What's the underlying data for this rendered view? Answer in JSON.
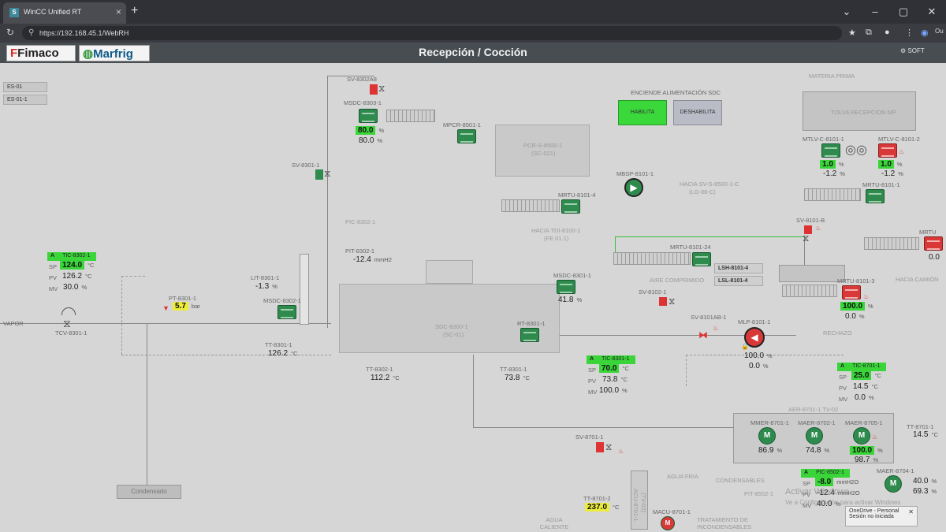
{
  "browser": {
    "tab_title": "WinCC Unified RT",
    "favicon": "S",
    "url": "https://192.168.45.1/WebRH",
    "profile": "Ou"
  },
  "header": {
    "title": "Recepción / Cocción",
    "logo1": "Fimaco",
    "logo2": "Marfrig",
    "logo3": "SOFT"
  },
  "side": {
    "es01": "ES-01",
    "es011": "ES-01-1"
  },
  "sdc": {
    "label": "ENCIENDE ALIMENTACIÓN SDC",
    "habilita": "HABILITA",
    "deshabilita": "DESHABILITA"
  },
  "tags": {
    "sv8302a8": "SV-8302A8",
    "msdc8303": "MSDC-8303-1",
    "msdc8303_v1": "80.0",
    "msdc8303_v2": "80.0",
    "mpcr8501": "MPCR-8501-1",
    "pcr": "PCR-S-8500-1",
    "pcr2": "(SC-021)",
    "sv8301": "SV-8301-1",
    "mbsp8101": "MBSP-8101-1",
    "hacia_sv": "HACIA SV-S-8500-1-C",
    "hacia_sv2": "(LG-06-C)",
    "mrtu8101_4": "MRTU-8101-4",
    "hacia_tdi": "HACIA TDI-8100-1",
    "hacia_tdi2": "(FE 01.1)",
    "pic8302": "PIC-8302-1",
    "pit8302": "PIT-8302-1",
    "pit8302_v": "-12.4",
    "pit8302_u": "mmH2",
    "lit8301": "LIT-8301-1",
    "lit8301_v": "-1.3",
    "lit8301_u": "%",
    "msdc8302": "MSDC-8302-1",
    "msdc8301": "MSDC-8301-1",
    "msdc8301_v": "41.8",
    "msdc8301_u": "%",
    "sdc": "SDC-8300-1",
    "sdc2": "(SC-01)",
    "rt8301": "RT-8301-1",
    "tt8301": "TT-8301-1",
    "tt8301_v": "126.2",
    "tt8301_u": "°C",
    "tt8302": "TT-8302-1",
    "tt8302_v": "112.2",
    "tt8302_u": "°C",
    "tt8301b": "TT-8301-1",
    "tt8301b_v": "73.8",
    "tt8301b_u": "°C",
    "tic8302": "TIC-8302-1",
    "tic8302_mode": "A",
    "tic8302_sp": "124.0",
    "tic8302_pv": "126.2",
    "tic8302_mv": "30.0",
    "pt8301": "PT-8301-1",
    "pt8301_v": "5.7",
    "pt8301_u": "bar",
    "vapor": "VAPOR",
    "tcv8301": "TCV-8301-1",
    "condensado": "Condensado",
    "mrtu8101_24": "MRTU-8101-24",
    "aire": "AIRE COMPRIMIDO",
    "sv8102": "SV-8102-1",
    "sv8101ab": "SV-8101AB-1",
    "mlp8101": "MLP-8101-1",
    "mlp_v1": "100.0",
    "mlp_v2": "0.0",
    "tic8301": "TIC-8301-1",
    "tic8301_mode": "A",
    "tic8301_sp": "70.0",
    "tic8301_pv": "73.8",
    "tic8301_mv": "100.0",
    "lsh8101": "LSH-8101-4",
    "lsl8101": "LSL-8101-4",
    "mrtu8101_3": "MRTU-8101-3",
    "mrtu8101_3_v1": "100.0",
    "mrtu8101_3_v2": "0.0",
    "rechazo": "RECHAZO",
    "materia": "MATERIA PRIMA",
    "tolva": "TOLVA RECEPCION MP",
    "mtlv1": "MTLV-C-8101-1",
    "mtlv1_v1": "1.0",
    "mtlv1_v2": "-1.2",
    "mtlv2": "MTLV-C-8101-2",
    "mtlv2_v1": "1.0",
    "mtlv2_v2": "-1.2",
    "mrtu8101_1": "MRTU-8101-1",
    "sv8101b": "SV-8101-B",
    "mrtu_right": "MRTU",
    "mrtu_right_v": "0.0",
    "hacia_camion": "HACIA CAMIÓN",
    "tic8701": "TIC-8701-1",
    "tic8701_mode": "A",
    "tic8701_sp": "25.0",
    "tic8701_pv": "14.5",
    "tic8701_mv": "0.0",
    "aer": "AER-8701-1 TV-02",
    "mmer1": "MMER-8701-1",
    "mmer1_v": "86.9",
    "maer2": "MAER-8702-1",
    "maer2_v": "74.8",
    "maer5": "MAER-8705-1",
    "maer5_v1": "100.0",
    "maer5_v2": "98.7",
    "tt8701": "TT-8701-1",
    "tt8701_v": "14.5",
    "tt8701_u": "°C",
    "maer8704": "MAER-8704-1",
    "maer8704_v1": "40.0",
    "maer8704_v2": "69.3",
    "condensables": "CONDENSABLES",
    "pic8502": "PIC-8502-1",
    "pic8502_mode": "A",
    "pic8502_sp": "-8.0",
    "pic8502_pv": "-12.4",
    "pic8502_mv": "40.0",
    "pic8502_u": "mmH2O",
    "pit8502": "PIT-8502-1",
    "sv8701": "SV-8701-1",
    "agua_fria": "AGUA FRIA",
    "tt8701_2": "TT-8701-2",
    "tt8701_2_v": "237.0",
    "tt8701_2_u": "°C",
    "acu": "ACU-8701-1",
    "acu2": "(TV-02)",
    "macu": "MACU-8701-1",
    "agua_caliente": "AGUA CALIENTE",
    "tratamiento": "TRATAMIENTO DE INCONDENSABLES",
    "activate": "Activar Windows",
    "activate2": "Ve a Configuración para activar Windows",
    "onedrive": "OneDrive - Personal",
    "onedrive2": "Sesión no iniciada"
  },
  "labels": {
    "sp": "SP",
    "pv": "PV",
    "mv": "MV",
    "pct": "%",
    "degc": "°C",
    "M": "M"
  }
}
